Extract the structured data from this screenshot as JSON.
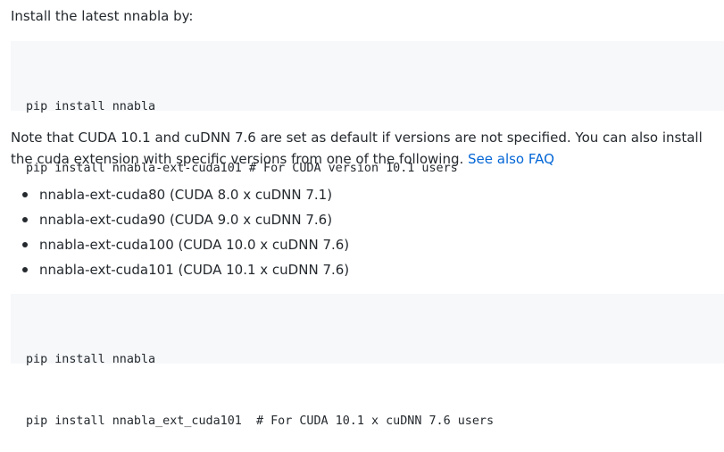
{
  "intro_text": "Install the latest nnabla by:",
  "code_block_1": {
    "lines": [
      "pip install nnabla",
      "pip install nnabla-ext-cuda101 # For CUDA version 10.1 users"
    ]
  },
  "note": {
    "text": "Note that CUDA 10.1 and cuDNN 7.6 are set as default if versions are not specified. You can also install the cuda extension with specific versions from one of the following. ",
    "link_label": "See also FAQ"
  },
  "bullets": [
    "nnabla-ext-cuda80 (CUDA 8.0 x cuDNN 7.1)",
    "nnabla-ext-cuda90 (CUDA 9.0 x cuDNN 7.6)",
    "nnabla-ext-cuda100 (CUDA 10.0 x cuDNN 7.6)",
    "nnabla-ext-cuda101 (CUDA 10.1 x cuDNN 7.6)"
  ],
  "code_block_2": {
    "lines": [
      "pip install nnabla",
      "pip install nnabla_ext_cuda101  # For CUDA 10.1 x cuDNN 7.6 users"
    ]
  },
  "colors": {
    "text": "#24292e",
    "link": "#0366d6",
    "code_background": "#f6f8fa"
  }
}
